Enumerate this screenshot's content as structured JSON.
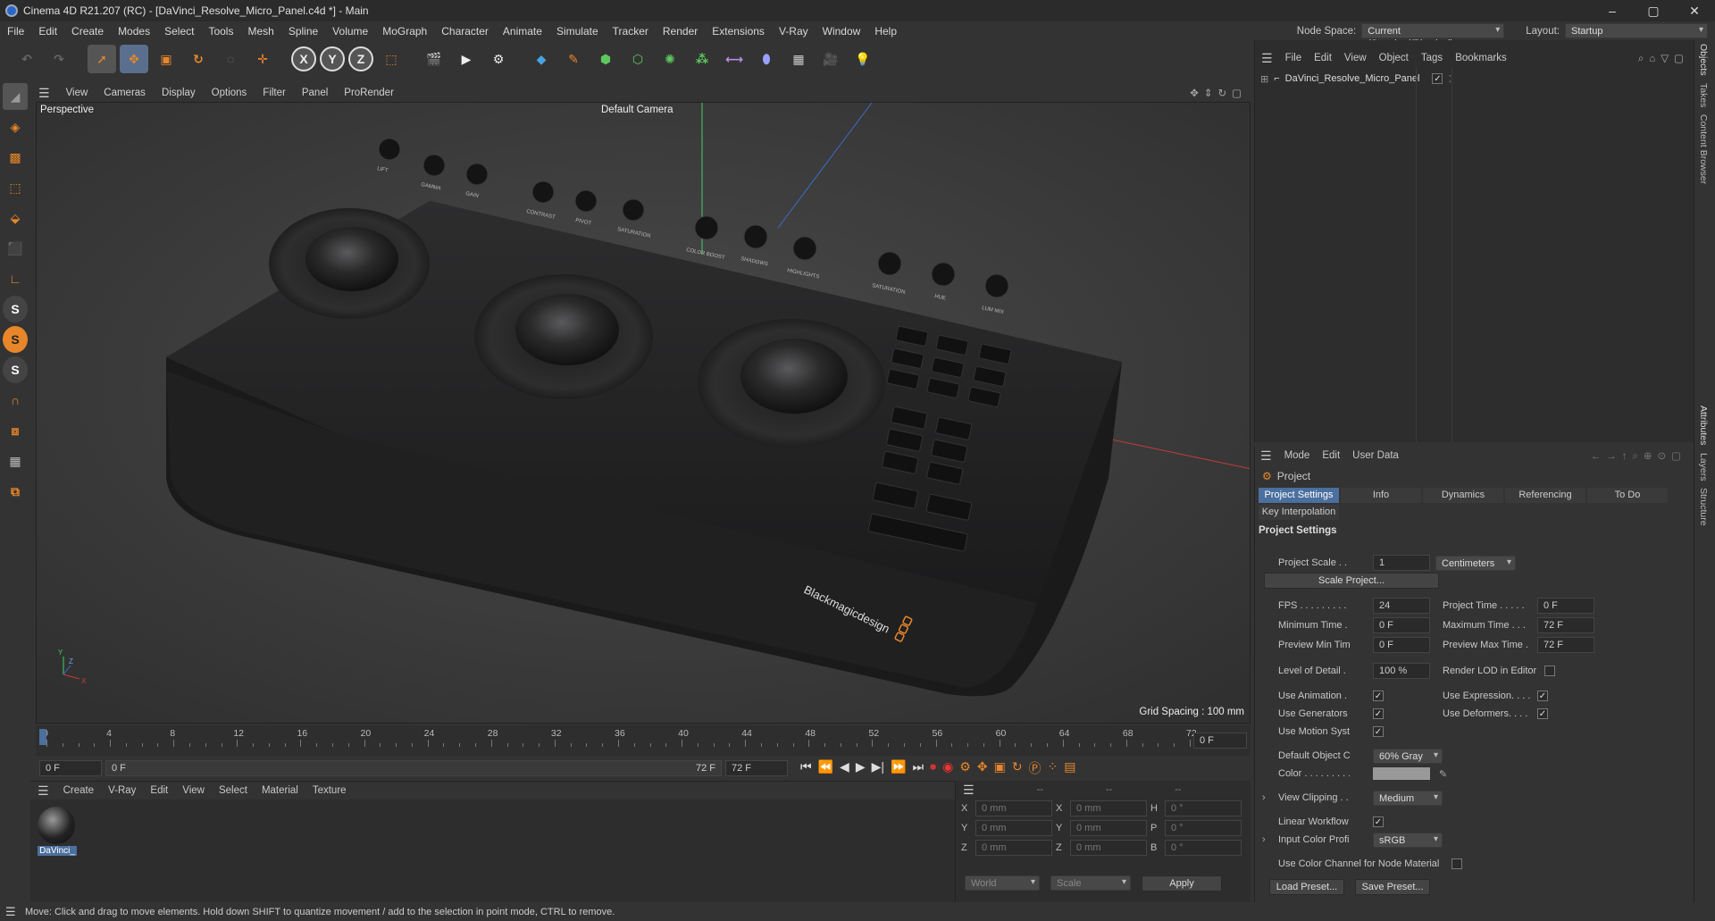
{
  "window": {
    "title": "Cinema 4D R21.207 (RC) - [DaVinci_Resolve_Micro_Panel.c4d *] - Main",
    "minimize": "–",
    "maximize": "▢",
    "close": "✕"
  },
  "menubar": {
    "items": [
      "File",
      "Edit",
      "Create",
      "Modes",
      "Select",
      "Tools",
      "Mesh",
      "Spline",
      "Volume",
      "MoGraph",
      "Character",
      "Animate",
      "Simulate",
      "Tracker",
      "Render",
      "Extensions",
      "V-Ray",
      "Window",
      "Help"
    ]
  },
  "nodespace": {
    "label": "Node Space:",
    "value": "Current (Standard/Physical)",
    "layout_label": "Layout:",
    "layout_value": "Startup"
  },
  "viewport": {
    "menu": [
      "View",
      "Cameras",
      "Display",
      "Options",
      "Filter",
      "Panel",
      "ProRender"
    ],
    "perspective": "Perspective",
    "camera": "Default Camera",
    "grid_spacing": "Grid Spacing : 100 mm",
    "device_brand": "Blackmagicdesign",
    "knob_labels": [
      "LIFT",
      "GAMMA",
      "GAIN",
      "CONTRAST",
      "PIVOT",
      "SATURATION",
      "COLOR BOOST",
      "SHADOWS",
      "HIGHLIGHTS",
      "SATURATION",
      "HUE",
      "LUM MIX"
    ]
  },
  "timeline": {
    "ticks": [
      "0",
      "4",
      "8",
      "12",
      "16",
      "20",
      "24",
      "28",
      "32",
      "36",
      "40",
      "44",
      "48",
      "52",
      "56",
      "60",
      "64",
      "68",
      "72"
    ],
    "current_frame": "0 F",
    "start_field": "0 F",
    "range_start": "0 F",
    "range_end": "72 F",
    "end_field": "72 F"
  },
  "material_manager": {
    "menu": [
      "Create",
      "V-Ray",
      "Edit",
      "View",
      "Select",
      "Material",
      "Texture"
    ],
    "material_name": "DaVinci_"
  },
  "coordinates": {
    "header": [
      "--",
      "--",
      "--"
    ],
    "rows": [
      {
        "a": "X",
        "av": "0 mm",
        "b": "X",
        "bv": "0 mm",
        "c": "H",
        "cv": "0 °"
      },
      {
        "a": "Y",
        "av": "0 mm",
        "b": "Y",
        "bv": "0 mm",
        "c": "P",
        "cv": "0 °"
      },
      {
        "a": "Z",
        "av": "0 mm",
        "b": "Z",
        "bv": "0 mm",
        "c": "B",
        "cv": "0 °"
      }
    ],
    "world": "World",
    "scale": "Scale",
    "apply": "Apply"
  },
  "object_manager": {
    "menu": [
      "File",
      "Edit",
      "View",
      "Object",
      "Tags",
      "Bookmarks"
    ],
    "object_name": "DaVinci_Resolve_Micro_Panel"
  },
  "attributes": {
    "menu": [
      "Mode",
      "Edit",
      "User Data"
    ],
    "section": "Project",
    "tabs": [
      "Project Settings",
      "Info",
      "Dynamics",
      "Referencing",
      "To Do"
    ],
    "tab2": "Key Interpolation",
    "heading": "Project Settings",
    "project_scale_label": "Project Scale . . . . .",
    "project_scale_value": "1",
    "project_scale_unit": "Centimeters",
    "scale_project_button": "Scale Project...",
    "fps_label": "FPS . . . . . . . . . . . .",
    "fps_value": "24",
    "project_time_label": "Project Time . . . . .",
    "project_time_value": "0 F",
    "min_time_label": "Minimum Time . . . .",
    "min_time_value": "0 F",
    "max_time_label": "Maximum Time . . .",
    "max_time_value": "72 F",
    "prev_min_label": "Preview Min Time . .",
    "prev_min_value": "0 F",
    "prev_max_label": "Preview Max Time .",
    "prev_max_value": "72 F",
    "lod_label": "Level of Detail . . . .",
    "lod_value": "100 %",
    "render_lod_label": "Render LOD in Editor",
    "use_animation_label": "Use Animation . . . .",
    "use_expression_label": "Use Expression. . . .",
    "use_generators_label": "Use Generators . . . .",
    "use_deformers_label": "Use Deformers. . . .",
    "use_motion_label": "Use Motion System",
    "default_color_label": "Default Object Color",
    "default_color_value": "60% Gray",
    "color_label": "Color . . . . . . . . . . .",
    "view_clipping_label": "View Clipping . . . . .",
    "view_clipping_value": "Medium",
    "linear_workflow_label": "Linear Workflow . . .",
    "input_color_label": "Input Color Profile . .",
    "input_color_value": "sRGB",
    "color_channel_label": "Use Color Channel for Node Material",
    "load_preset": "Load Preset...",
    "save_preset": "Save Preset..."
  },
  "right_tabs": [
    "Objects",
    "Takes",
    "Content Browser",
    "Attributes",
    "Layers",
    "Structure"
  ],
  "statusbar": {
    "text": "Move: Click and drag to move elements. Hold down SHIFT to quantize movement / add to the selection in point mode, CTRL to remove."
  },
  "colors": {
    "accent": "#4b6f9e",
    "orange": "#e8862a"
  }
}
